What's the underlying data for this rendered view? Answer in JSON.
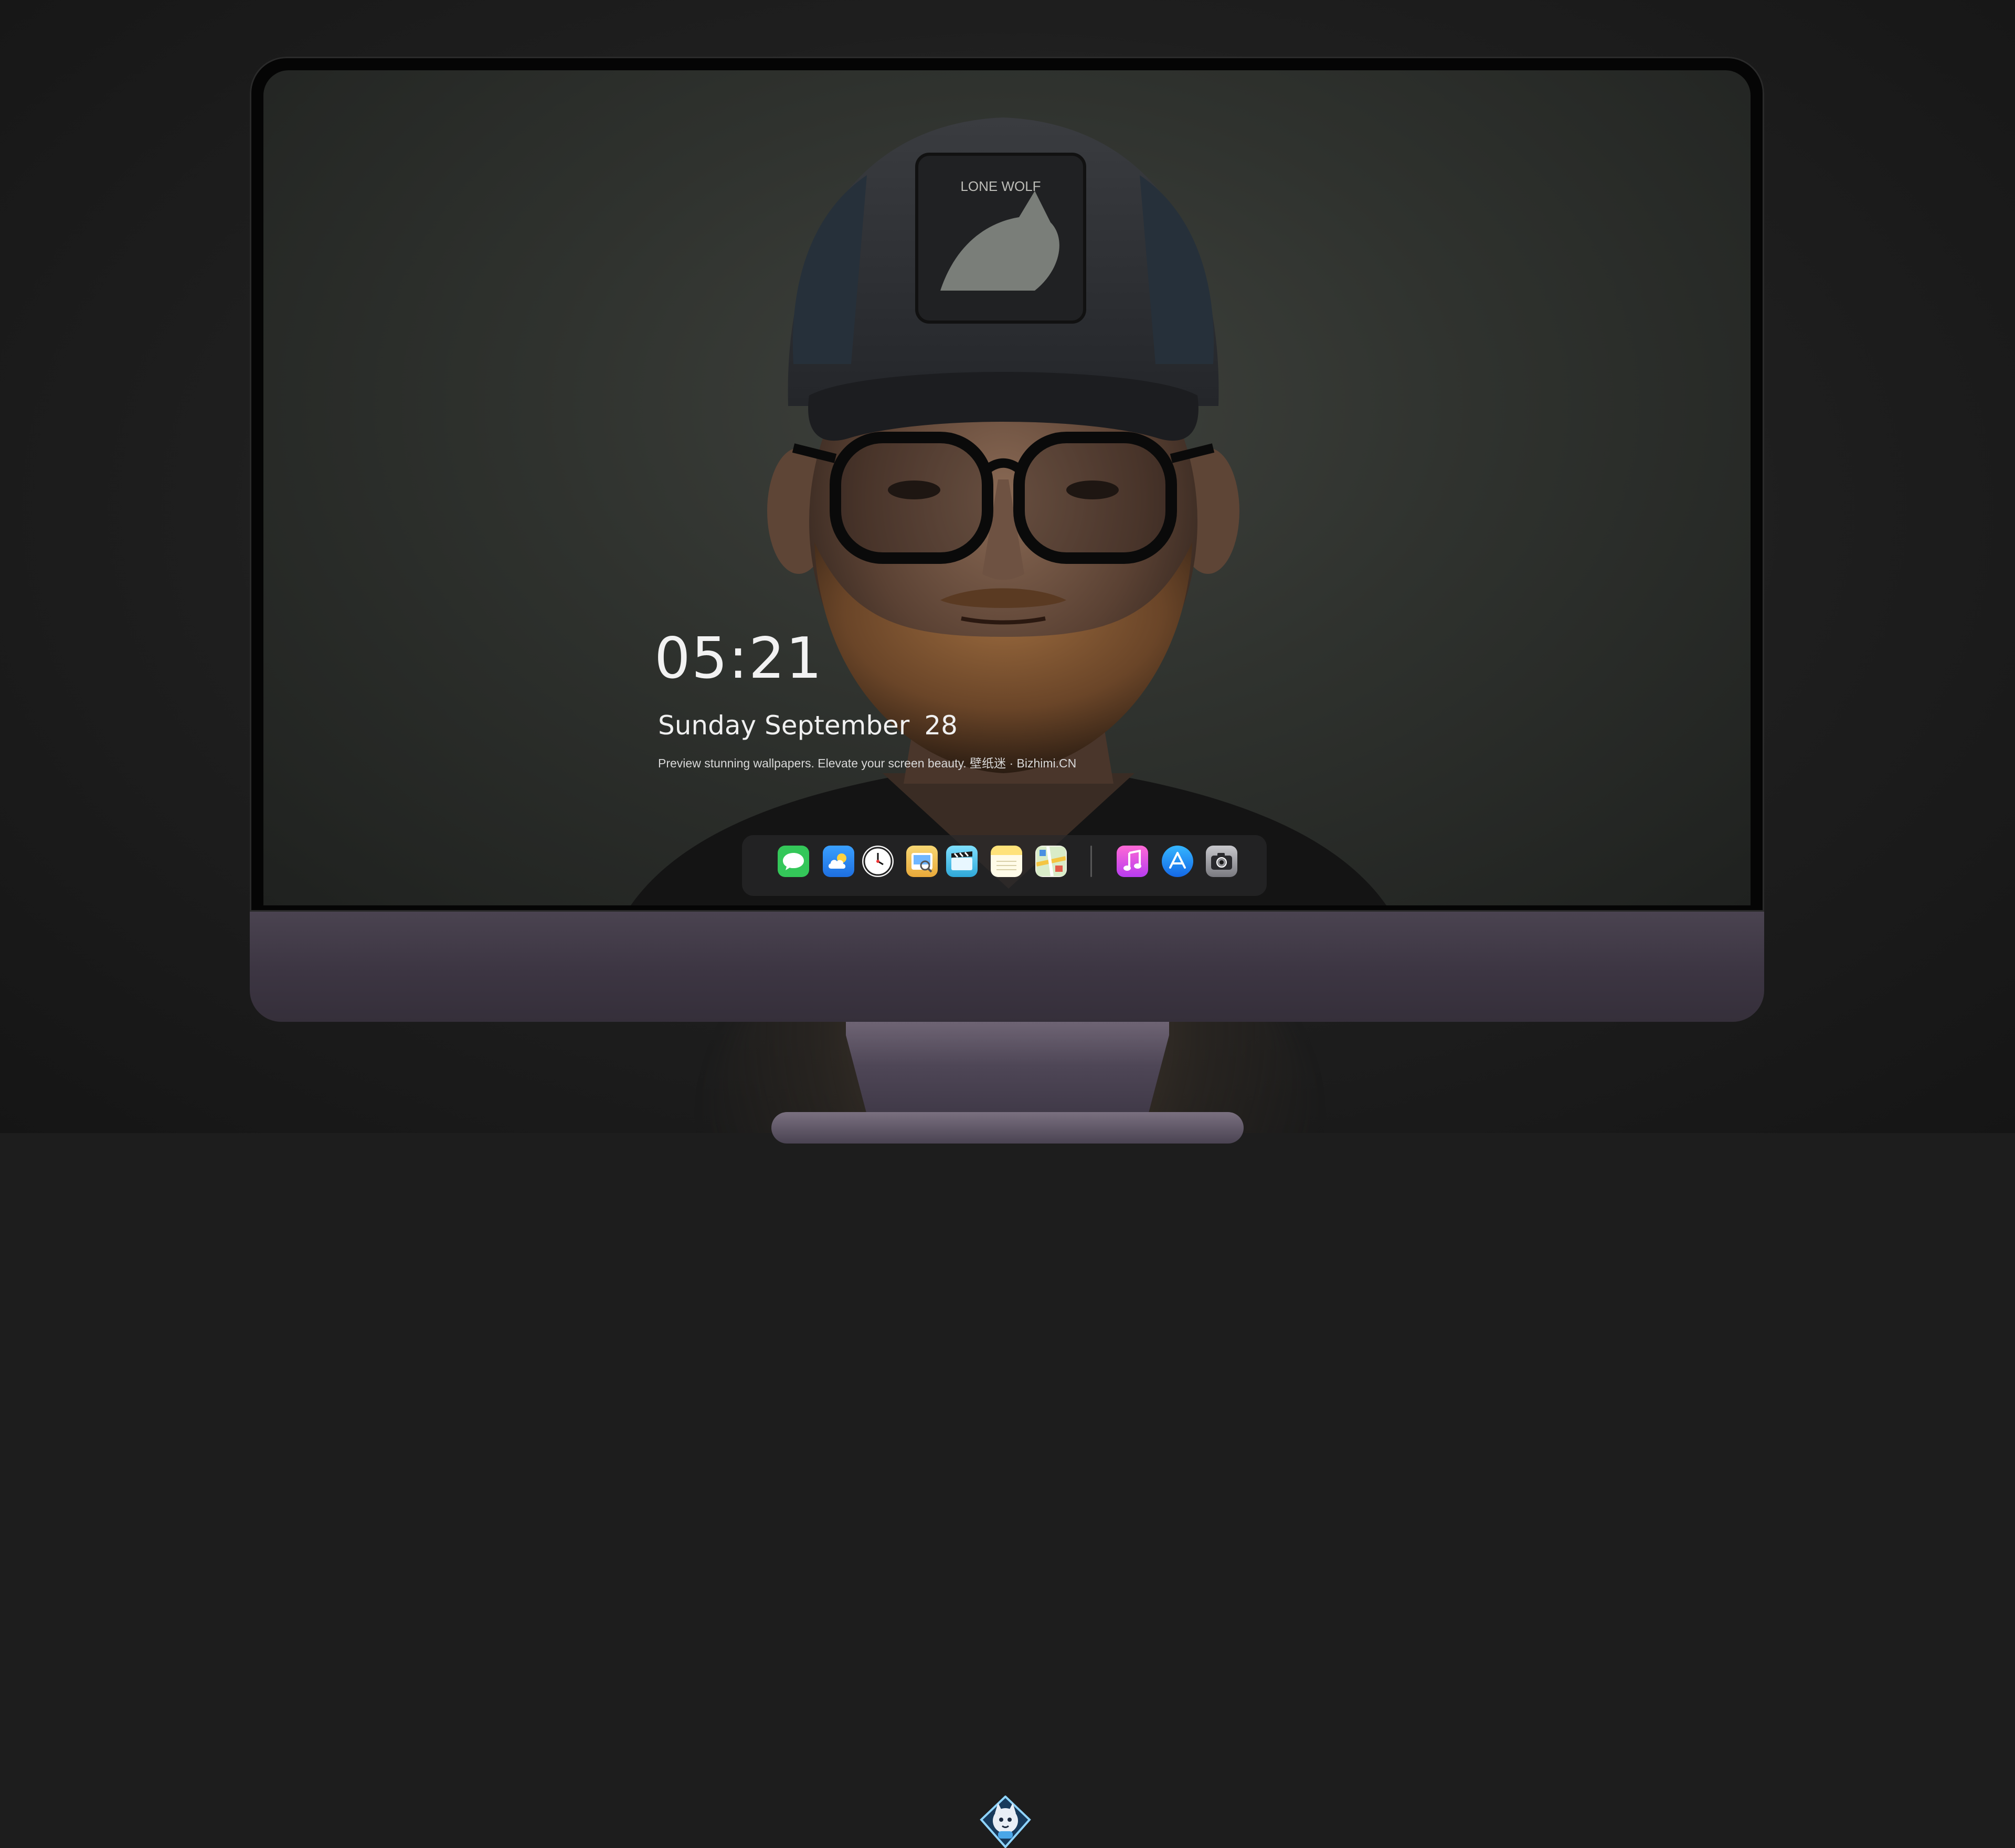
{
  "lock_screen": {
    "time": "05:21",
    "weekday": "Sunday",
    "month": "September",
    "day": "28",
    "tagline": "Preview stunning wallpapers. Elevate your screen beauty. 壁纸迷 · Bizhimi.CN"
  },
  "wallpaper": {
    "cap_patch_text": "LONE WOLF"
  },
  "dock": {
    "apps": [
      {
        "name": "messages-icon",
        "color": "#34c759"
      },
      {
        "name": "weather-icon",
        "color": "#2f8cf5"
      },
      {
        "name": "clock-icon",
        "color": "#ffffff"
      },
      {
        "name": "preview-icon",
        "color": "#f2c94c"
      },
      {
        "name": "video-editor-icon",
        "color": "#5ac8fa"
      },
      {
        "name": "notes-icon",
        "color": "#ffd54f"
      },
      {
        "name": "maps-icon",
        "color": "#4cd964"
      },
      {
        "name": "music-icon",
        "color": "#e94cf5"
      },
      {
        "name": "app-store-icon",
        "color": "#1e90ff"
      },
      {
        "name": "camera-icon",
        "color": "#8e8e93"
      }
    ]
  }
}
